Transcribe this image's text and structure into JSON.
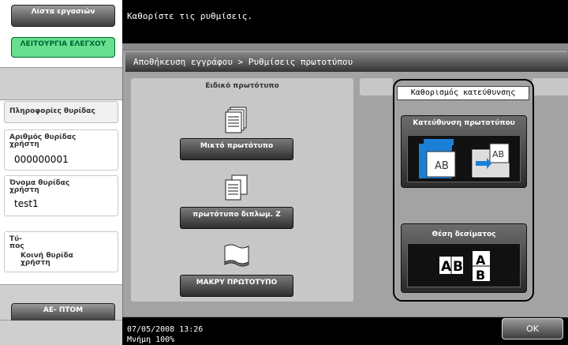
{
  "left_panel": {
    "tools_button": "Λίστα εργασιών",
    "function_check_button": "ΛΕΙΤΟΥΡΓΙΑ ΕΛΕΓΧΟΥ",
    "info_label": "Πληροφορίες θυρίδας",
    "user_box_number_label": "Αριθμός θυρίδας χρήστη",
    "user_box_number_value": "000000001",
    "user_box_name_label": "Όνομα θυρίδας χρήστη",
    "user_box_name_value": "test1",
    "type_label": "Τύ- πος",
    "type_value": "Κοινή θυρίδα χρήστη",
    "back_button": "ΑΕ- ΠΤΟΜ"
  },
  "header": {
    "instruction": "Καθορίστε τις ρυθμίσεις.",
    "breadcrumb": "Αποθήκευση εγγράφου > Ρυθμίσεις πρωτοτύπου"
  },
  "special_original": {
    "title": "Ειδικό πρωτότυπο",
    "mixed_button": "Μικτό πρωτότυπο",
    "zfold_button": "πρωτότυπο διπλωμ. Z",
    "long_button": "ΜΑΚΡΥ ΠΡΩΤΟΤΥΠΟ"
  },
  "orientation": {
    "title": "Καθορισμός κατεύθυνσης",
    "direction_button": "Κατεύθυνση πρωτοτύπου",
    "paper_position_button": "Θέση δεσίματος"
  },
  "footer": {
    "datetime": "07/05/2008   13:26",
    "memory": "Μνήμη        100%",
    "ok_button": "OK"
  },
  "colors": {
    "function_button": "#66e08e",
    "icon_blue": "#1a7fd6"
  }
}
